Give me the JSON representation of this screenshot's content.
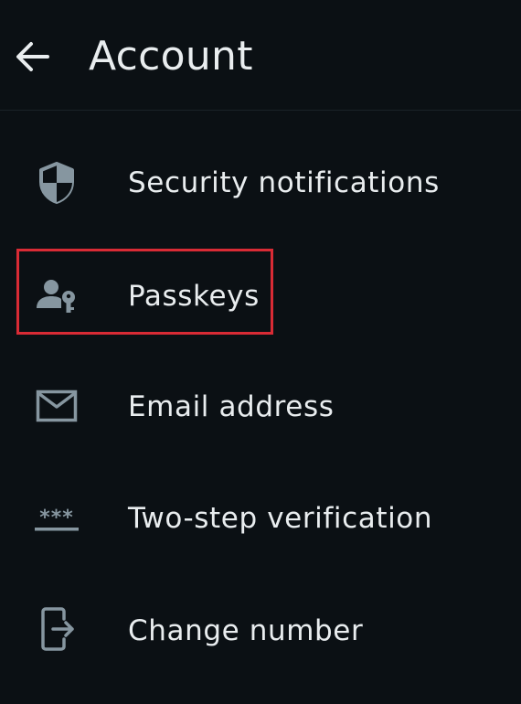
{
  "header": {
    "title": "Account",
    "back_icon": "arrow-left-icon"
  },
  "menu": {
    "items": [
      {
        "label": "Security notifications",
        "icon": "shield-icon"
      },
      {
        "label": "Passkeys",
        "icon": "person-key-icon"
      },
      {
        "label": "Email address",
        "icon": "envelope-icon"
      },
      {
        "label": "Two-step verification",
        "icon": "password-dots-icon"
      },
      {
        "label": "Change number",
        "icon": "phone-transfer-icon"
      }
    ]
  },
  "colors": {
    "background": "#0b1014",
    "text": "#e9edef",
    "icon": "#8696a0",
    "highlight": "#d92b35"
  }
}
